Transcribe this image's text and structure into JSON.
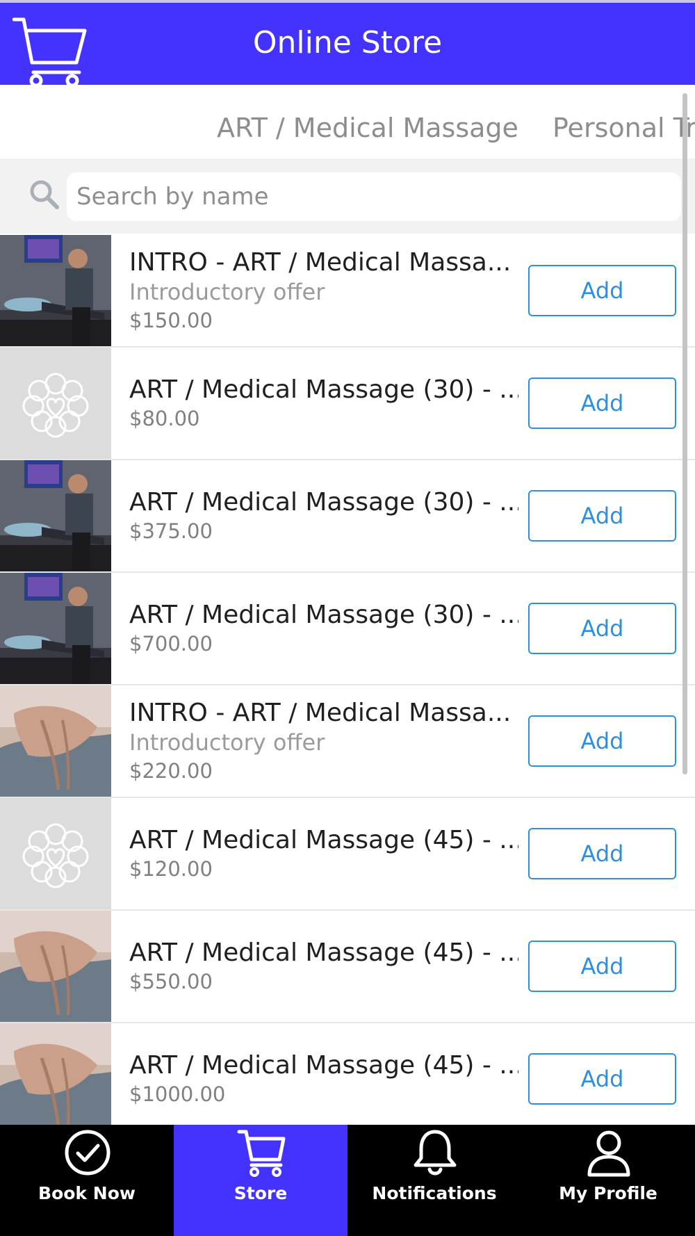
{
  "header": {
    "title": "Online Store",
    "icon": "cart-icon",
    "color": "#4433ff"
  },
  "tabs": [
    {
      "label": "ART / Medical Massage"
    },
    {
      "label": "Personal Tr"
    }
  ],
  "search": {
    "placeholder": "Search by name",
    "value": ""
  },
  "products": [
    {
      "name": "INTRO - ART / Medical Massa...",
      "subtitle": "Introductory offer",
      "price": "$150.00",
      "image": "therapist-photo",
      "button": "Add"
    },
    {
      "name": "ART / Medical Massage (30) - ...",
      "subtitle": "",
      "price": "$80.00",
      "image": "logo-placeholder",
      "button": "Add"
    },
    {
      "name": "ART / Medical Massage (30) - ...",
      "subtitle": "",
      "price": "$375.00",
      "image": "therapist-photo",
      "button": "Add"
    },
    {
      "name": "ART / Medical Massage (30) - ...",
      "subtitle": "",
      "price": "$700.00",
      "image": "therapist-photo",
      "button": "Add"
    },
    {
      "name": "INTRO - ART / Medical Massa...",
      "subtitle": "Introductory offer",
      "price": "$220.00",
      "image": "neck-massage-photo",
      "button": "Add"
    },
    {
      "name": "ART / Medical Massage (45) - ...",
      "subtitle": "",
      "price": "$120.00",
      "image": "logo-placeholder",
      "button": "Add"
    },
    {
      "name": "ART / Medical Massage (45) - ...",
      "subtitle": "",
      "price": "$550.00",
      "image": "neck-massage-photo",
      "button": "Add"
    },
    {
      "name": "ART / Medical Massage (45) - ...",
      "subtitle": "",
      "price": "$1000.00",
      "image": "neck-massage-photo",
      "button": "Add"
    }
  ],
  "bottom_nav": [
    {
      "label": "Book Now",
      "icon": "check-circle-icon",
      "active": false
    },
    {
      "label": "Store",
      "icon": "cart-icon",
      "active": true
    },
    {
      "label": "Notifications",
      "icon": "bell-icon",
      "active": false
    },
    {
      "label": "My Profile",
      "icon": "user-icon",
      "active": false
    }
  ],
  "colors": {
    "accent": "#4433ff",
    "button": "#2e8fe0",
    "nav_bg": "#000000"
  }
}
